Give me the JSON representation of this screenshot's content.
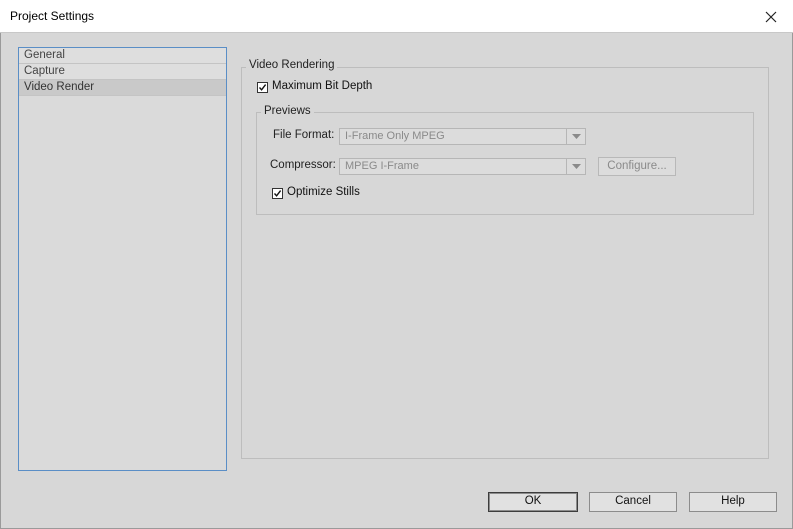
{
  "window": {
    "title": "Project Settings"
  },
  "sidebar": {
    "items": [
      {
        "label": "General"
      },
      {
        "label": "Capture"
      },
      {
        "label": "Video Render",
        "selected": true
      }
    ]
  },
  "video_rendering": {
    "group_label": "Video Rendering",
    "max_bit_depth": {
      "label": "Maximum Bit Depth",
      "checked": true
    },
    "previews": {
      "group_label": "Previews",
      "file_format": {
        "label": "File Format:",
        "value": "I-Frame Only MPEG",
        "enabled": false
      },
      "compressor": {
        "label": "Compressor:",
        "value": "MPEG I-Frame",
        "enabled": false
      },
      "configure_label": "Configure...",
      "optimize_stills": {
        "label": "Optimize Stills",
        "checked": true
      }
    }
  },
  "footer": {
    "ok_label": "OK",
    "cancel_label": "Cancel",
    "help_label": "Help"
  },
  "colors": {
    "selection_border": "#5a8ec6",
    "dialog_bg": "#d7d7d7"
  }
}
